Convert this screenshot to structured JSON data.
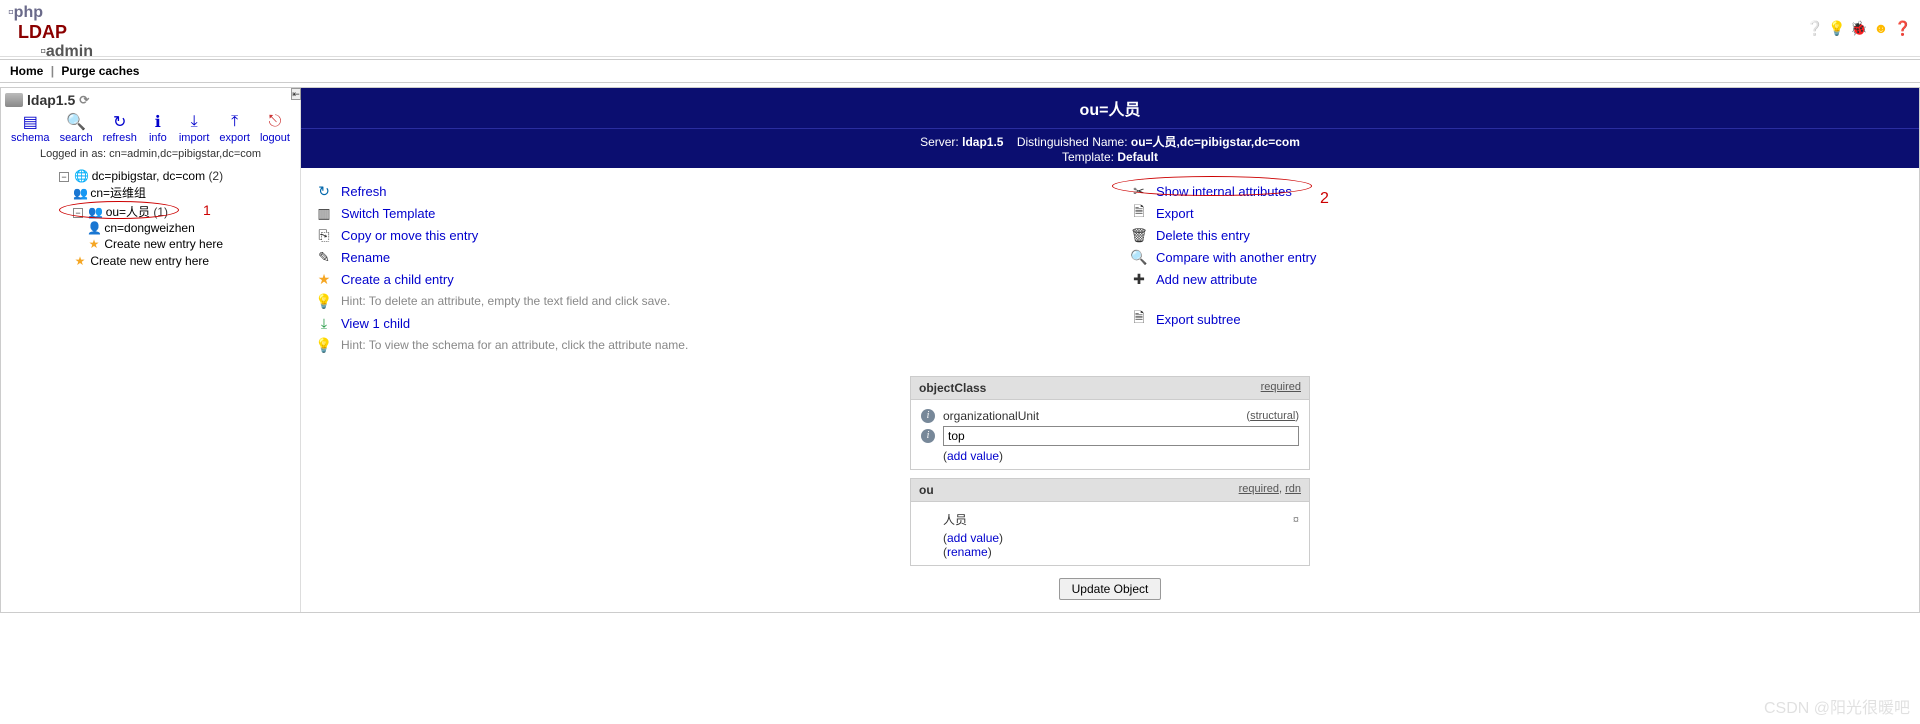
{
  "menu": {
    "home": "Home",
    "purge": "Purge caches"
  },
  "server": {
    "name": "ldap1.5",
    "logged_in_prefix": "Logged in as: ",
    "logged_in_dn": "cn=admin,dc=pibigstar,dc=com"
  },
  "toolbar": [
    {
      "id": "schema",
      "label": "schema",
      "glyph": "▤"
    },
    {
      "id": "search",
      "label": "search",
      "glyph": "🔍"
    },
    {
      "id": "refresh",
      "label": "refresh",
      "glyph": "↻"
    },
    {
      "id": "info",
      "label": "info",
      "glyph": "ℹ"
    },
    {
      "id": "import",
      "label": "import",
      "glyph": "⤓"
    },
    {
      "id": "export",
      "label": "export",
      "glyph": "⤒"
    },
    {
      "id": "logout",
      "label": "logout",
      "glyph": "⎋"
    }
  ],
  "tree": {
    "root": {
      "label": "dc=pibigstar, dc=com",
      "count": "(2)"
    },
    "n1": {
      "label": "cn=运维组"
    },
    "n2": {
      "label": "ou=人员",
      "count": "(1)"
    },
    "n3": {
      "label": "cn=dongweizhen"
    },
    "newhere": "Create new entry here"
  },
  "title": "ou=人员",
  "infobar": {
    "server_lbl": "Server:",
    "server_val": "ldap1.5",
    "dn_lbl": "Distinguished Name:",
    "dn_val": "ou=人员,dc=pibigstar,dc=com",
    "tpl_lbl": "Template:",
    "tpl_val": "Default"
  },
  "actions_left": [
    {
      "id": "refresh",
      "label": "Refresh",
      "glyph": "↻"
    },
    {
      "id": "switch-template",
      "label": "Switch Template",
      "glyph": "▥"
    },
    {
      "id": "copy-move",
      "label": "Copy or move this entry",
      "glyph": "⎘"
    },
    {
      "id": "rename",
      "label": "Rename",
      "glyph": "✎"
    },
    {
      "id": "create-child",
      "label": "Create a child entry",
      "glyph": "★",
      "star": true
    }
  ],
  "hint1": "Hint: To delete an attribute, empty the text field and click save.",
  "view_children": "View 1 child",
  "hint2": "Hint: To view the schema for an attribute, click the attribute name.",
  "actions_right": [
    {
      "id": "show-internal",
      "label": "Show internal attributes",
      "glyph": "✂"
    },
    {
      "id": "export",
      "label": "Export",
      "glyph": "🗎"
    },
    {
      "id": "delete",
      "label": "Delete this entry",
      "glyph": "🗑"
    },
    {
      "id": "compare",
      "label": "Compare with another entry",
      "glyph": "🔍"
    },
    {
      "id": "add-attr",
      "label": "Add new attribute",
      "glyph": "✚"
    }
  ],
  "export_subtree": "Export subtree",
  "attrs": {
    "oc": {
      "name": "objectClass",
      "req": "required",
      "v1": "organizationalUnit",
      "struct": "structural",
      "v2": "top",
      "add": "add value"
    },
    "ou": {
      "name": "ou",
      "req": "required",
      "rdn": "rdn",
      "v1": "人员",
      "add": "add value",
      "rename": "rename"
    }
  },
  "update_btn": "Update Object",
  "watermark": "CSDN @阳光很暖吧",
  "annotations": {
    "a1": "1",
    "a2": "2"
  }
}
